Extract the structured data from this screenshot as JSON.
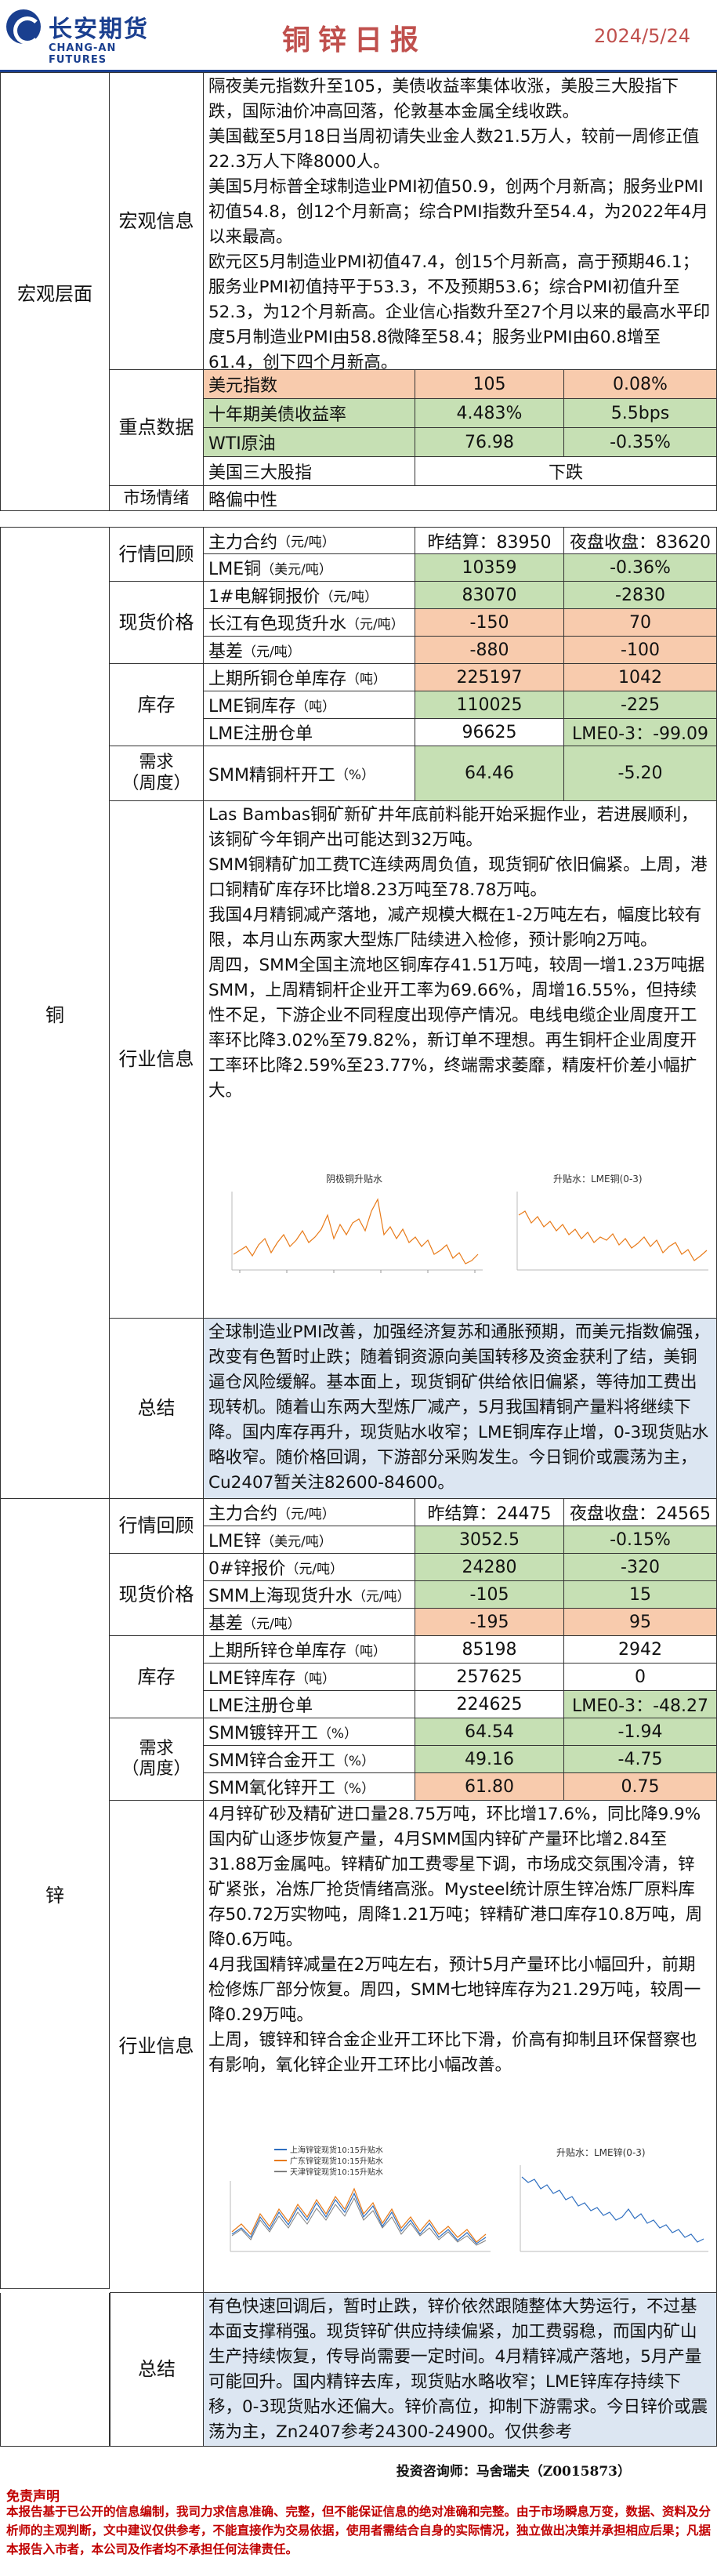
{
  "header": {
    "logo_cn": "长安期货",
    "logo_en": "CHANG-AN FUTURES",
    "title": "铜锌日报",
    "date": "2024/5/24"
  },
  "macro": {
    "section": "宏观层面",
    "info_label": "宏观信息",
    "info_lines": [
      "隔夜美元指数升至105，美债收益率集体收涨，美股三大股指下跌，国际油价冲高回落，伦敦基本金属全线收跌。",
      "美国截至5月18日当周初请失业金人数21.5万人，较前一周修正值22.3万人下降8000人。",
      "美国5月标普全球制造业PMI初值50.9，创两个月新高；服务业PMI初值54.8，创12个月新高；综合PMI指数升至54.4，为2022年4月以来最高。",
      "欧元区5月制造业PMI初值47.4，创15个月新高，高于预期46.1；服务业PMI初值持平于53.3，不及预期53.6；综合PMI初值升至52.3，为12个月新高。企业信心指数升至27个月以来的最高水平印度5月制造业PMI由58.8微降至58.4；服务业PMI由60.8增至61.4，创下四个月新高。"
    ],
    "key_label": "重点数据",
    "key_rows": [
      {
        "name": "美元指数",
        "v1": "105",
        "v2": "0.08%"
      },
      {
        "name": "十年期美债收益率",
        "v1": "4.483%",
        "v2": "5.5bps"
      },
      {
        "name": "WTI原油",
        "v1": "76.98",
        "v2": "-0.35%"
      },
      {
        "name": "美国三大股指",
        "v1": "下跌",
        "v2": ""
      }
    ],
    "sentiment_label": "市场情绪",
    "sentiment": "略偏中性"
  },
  "copper": {
    "section": "铜",
    "review_label": "行情回顾",
    "review_rows": [
      {
        "name": "主力合约",
        "unit": "（元/吨）",
        "v1": "昨结算：83950",
        "v2": "夜盘收盘：83620"
      },
      {
        "name": "LME铜",
        "unit": "（美元/吨）",
        "v1": "10359",
        "v2": "-0.36%"
      }
    ],
    "spot_label": "现货价格",
    "spot_rows": [
      {
        "name": "1#电解铜报价",
        "unit": "（元/吨）",
        "v1": "83070",
        "v2": "-2830"
      },
      {
        "name": "长江有色现货升水",
        "unit": "（元/吨）",
        "v1": "-150",
        "v2": "70"
      },
      {
        "name": "基差",
        "unit": "（元/吨）",
        "v1": "-880",
        "v2": "-100"
      }
    ],
    "stock_label": "库存",
    "stock_rows": [
      {
        "name": "上期所铜仓单库存",
        "unit": "（吨）",
        "v1": "225197",
        "v2": "1042"
      },
      {
        "name": "LME铜库存",
        "unit": "（吨）",
        "v1": "110025",
        "v2": "-225"
      },
      {
        "name": "LME注册仓单",
        "unit": "",
        "v1": "96625",
        "v2": "LME0-3：-99.09"
      }
    ],
    "demand_label": "需求\n（周度）",
    "demand_rows": [
      {
        "name": "SMM精铜杆开工",
        "unit": "（%）",
        "v1": "64.46",
        "v2": "-5.20"
      }
    ],
    "industry_label": "行业信息",
    "industry_lines": [
      "Las Bambas铜矿新矿井年底前料能开始采掘作业，若进展顺利，该铜矿今年铜产出可能达到32万吨。",
      "SMM铜精矿加工费TC连续两周负值，现货铜矿依旧偏紧。上周，港口铜精矿库存环比增8.23万吨至78.78万吨。",
      "我国4月精铜减产落地，减产规模大概在1-2万吨左右，幅度比较有限，本月山东两家大型炼厂陆续进入检修，预计影响2万吨。",
      "周四，SMM全国主流地区铜库存41.51万吨，较周一增1.23万吨据SMM，上周精铜杆企业开工率为69.66%，周增16.55%，但持续性不足，下游企业不同程度出现停产情况。电线电缆企业周度开工率环比降3.02%至79.82%，新订单不理想。再生铜杆企业周度开工率环比降2.59%至23.77%，终端需求萎靡，精废杆价差小幅扩大。"
    ],
    "chart1_title": "阴极铜升贴水",
    "chart2_title": "升贴水：LME铜(0-3)",
    "summary_label": "总结",
    "summary": "全球制造业PMI改善，加强经济复苏和通胀预期，而美元指数偏强，改变有色暂时止跌；随着铜资源向美国转移及资金获利了结，美铜逼仓风险缓解。基本面上，现货铜矿供给依旧偏紧，等待加工费出现转机。随着山东两大型炼厂减产，5月我国精铜产量料将继续下降。国内库存再升，现货贴水收窄；LME铜库存止增，0-3现货贴水略收窄。随价格回调，下游部分采购发生。今日铜价或震荡为主，Cu2407暂关注82600-84600。"
  },
  "zinc": {
    "section": "锌",
    "review_label": "行情回顾",
    "review_rows": [
      {
        "name": "主力合约",
        "unit": "（元/吨）",
        "v1": "昨结算：24475",
        "v2": "夜盘收盘：24565"
      },
      {
        "name": "LME锌",
        "unit": "（美元/吨）",
        "v1": "3052.5",
        "v2": "-0.15%"
      }
    ],
    "spot_label": "现货价格",
    "spot_rows": [
      {
        "name": "0#锌报价",
        "unit": "（元/吨）",
        "v1": "24280",
        "v2": "-320"
      },
      {
        "name": "SMM上海现货升水",
        "unit": "（元/吨）",
        "v1": "-105",
        "v2": "15"
      },
      {
        "name": "基差",
        "unit": "（元/吨）",
        "v1": "-195",
        "v2": "95"
      }
    ],
    "stock_label": "库存",
    "stock_rows": [
      {
        "name": "上期所锌仓单库存",
        "unit": "（吨）",
        "v1": "85198",
        "v2": "2942"
      },
      {
        "name": "LME锌库存",
        "unit": "（吨）",
        "v1": "257625",
        "v2": "0"
      },
      {
        "name": "LME注册仓单",
        "unit": "",
        "v1": "224625",
        "v2": "LME0-3：-48.27"
      }
    ],
    "demand_label": "需求\n（周度）",
    "demand_rows": [
      {
        "name": "SMM镀锌开工",
        "unit": "（%）",
        "v1": "64.54",
        "v2": "-1.94"
      },
      {
        "name": "SMM锌合金开工",
        "unit": "（%）",
        "v1": "49.16",
        "v2": "-4.75"
      },
      {
        "name": "SMM氧化锌开工",
        "unit": "（%）",
        "v1": "61.80",
        "v2": "0.75"
      }
    ],
    "industry_label": "行业信息",
    "industry_lines": [
      "4月锌矿砂及精矿进口量28.75万吨，环比增17.6%，同比降9.9%国内矿山逐步恢复产量，4月SMM国内锌矿产量环比增2.84至31.88万金属吨。锌精矿加工费零星下调，市场成交氛围冷清，锌矿紧张，冶炼厂抢货情绪高涨。Mysteel统计原生锌冶炼厂原料库存50.72万实物吨，周降1.21万吨；锌精矿港口库存10.8万吨，周降0.6万吨。",
      "4月我国精锌减量在2万吨左右，预计5月产量环比小幅回升，前期检修炼厂部分恢复。周四，SMM七地锌库存为21.29万吨，较周一降0.29万吨。",
      "上周，镀锌和锌合金企业开工环比下滑，价高有抑制且环保督察也有影响，氧化锌企业开工环比小幅改善。"
    ],
    "chart1_legend": [
      "上海锌锭现货10:15升贴水",
      "广东锌锭现货10:15升贴水",
      "天津锌锭现货10:15升贴水"
    ],
    "chart2_title": "升贴水：LME锌(0-3)",
    "summary_label": "总结",
    "summary": "有色快速回调后，暂时止跌，锌价依然跟随整体大势运行，不过基本面支撑稍强。现货锌矿供应持续偏紧，加工费弱稳，而国内矿山生产持续恢复，传导尚需要一定时间。4月精锌减产落地，5月产量可能回升。国内精锌去库，现货贴水略收窄；LME锌库存持续下移，0-3现货贴水还偏大。锌价高位，抑制下游需求。今日锌价或震荡为主，Zn2407参考24300-24900。仅供参考"
  },
  "footer": {
    "advisor": "投资咨询师：马舍瑞夫（Z0015873）",
    "disclaimer_title": "免责声明",
    "disclaimer": "本报告基于已公开的信息编制，我司力求信息准确、完整，但不能保证信息的绝对准确和完整。由于市场瞬息万变，数据、资料及分析师的主观判断，文中建议仅供参考，不能直接作为交易依据，使用者需结合自身的实际情况，独立做出决策并承担相应后果；凡据本报告入市者，本公司及作者均不承担任何法律责任。"
  }
}
